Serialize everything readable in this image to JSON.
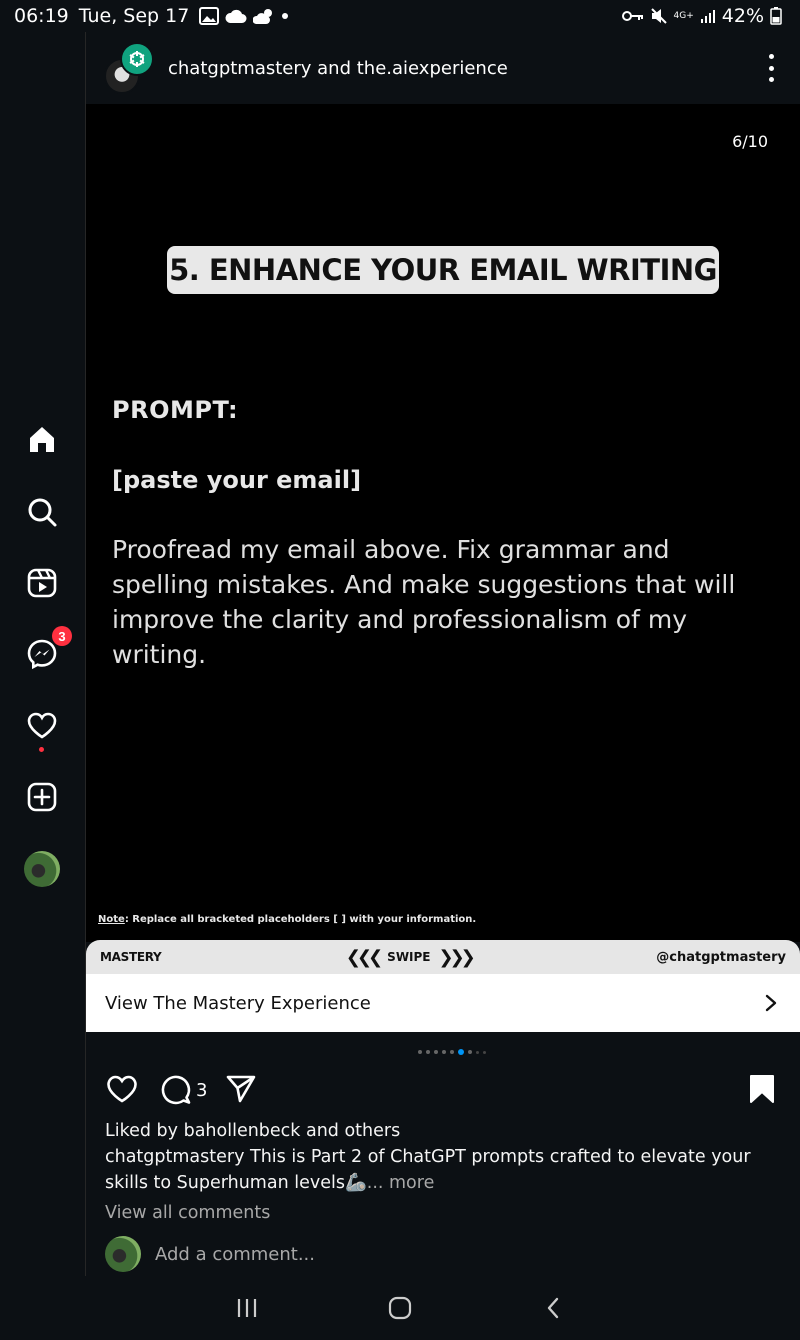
{
  "status_bar": {
    "time": "06:19",
    "date": "Tue, Sep 17",
    "network": "4G+",
    "battery": "42%"
  },
  "rail": {
    "items": [
      {
        "name": "home",
        "icon": "home-icon"
      },
      {
        "name": "search",
        "icon": "search-icon"
      },
      {
        "name": "reels",
        "icon": "reels-icon"
      },
      {
        "name": "messenger",
        "icon": "messenger-icon",
        "badge": "3"
      },
      {
        "name": "notifications",
        "icon": "heart-icon"
      },
      {
        "name": "create",
        "icon": "plus-square-icon"
      },
      {
        "name": "profile",
        "icon": "avatar"
      }
    ]
  },
  "post": {
    "authors": "chatgptmastery and the.aiexperience",
    "slide": {
      "counter": "6/10",
      "title": "5. ENHANCE YOUR EMAIL WRITING",
      "prompt_label": "PROMPT:",
      "placeholder": "[paste your email]",
      "body_lines": [
        "Proofread my email above. Fix grammar and",
        "spelling mistakes. And make suggestions that will",
        "improve the clarity and professionalism of my",
        "writing."
      ],
      "note_label": "Note",
      "note_text": ": Replace all bracketed placeholders [ ] with your information.",
      "footer_brand": "MASTERY",
      "footer_swipe": "SWIPE",
      "footer_handle": "@chatgptmastery"
    },
    "cta_label": "View The Mastery Experience",
    "pager": {
      "total": 10,
      "current": 6
    },
    "comment_count": "3",
    "likes_text": "Liked by bahollenbeck and others",
    "caption_author": "chatgptmastery",
    "caption_text": " This is Part 2 of ChatGPT prompts crafted to elevate your skills to Superhuman levels",
    "caption_emoji": "🦾",
    "caption_more": "... more",
    "view_comments": "View all comments",
    "add_comment_placeholder": "Add a comment..."
  },
  "colors": {
    "background": "#0c1014",
    "badge": "#ff3040",
    "pager_active": "#0095f6",
    "chatgpt_green": "#10a37f"
  }
}
